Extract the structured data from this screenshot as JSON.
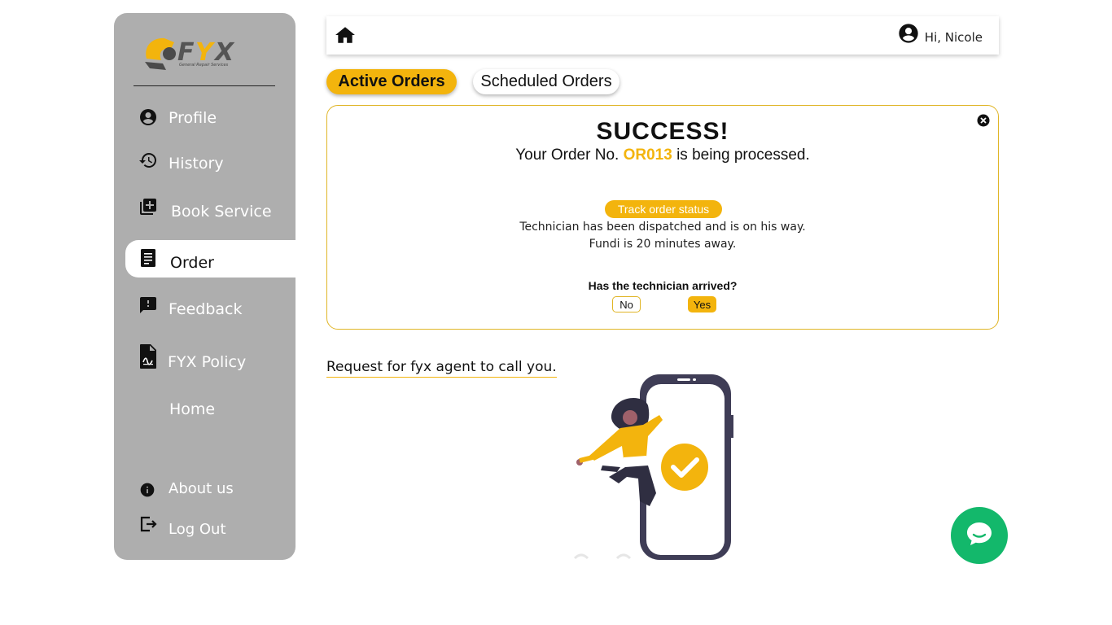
{
  "sidebar": {
    "logo_text": "FYX",
    "logo_tagline": "General Repair Services",
    "items": [
      {
        "label": "Profile",
        "icon": "account-circle-icon"
      },
      {
        "label": "History",
        "icon": "history-icon"
      },
      {
        "label": "Book Service",
        "icon": "library-add-icon"
      },
      {
        "label": "Order",
        "icon": "receipt-icon",
        "active": true
      },
      {
        "label": "Feedback",
        "icon": "feedback-icon"
      },
      {
        "label": "FYX Policy",
        "icon": "policy-document-icon"
      },
      {
        "label": "Home",
        "icon": ""
      }
    ],
    "bottom_items": [
      {
        "label": "About us",
        "icon": "info-icon"
      },
      {
        "label": "Log Out",
        "icon": "logout-icon"
      }
    ]
  },
  "header": {
    "greeting": "Hi, Nicole"
  },
  "tabs": {
    "active": "Active Orders",
    "scheduled": "Scheduled Orders"
  },
  "success_card": {
    "title": "SUCCESS!",
    "order_prefix": "Your Order No.",
    "order_number": "OR013",
    "order_suffix": "is being processed.",
    "track_button": "Track order status",
    "status_line_1": "Technician has been dispatched and is on his way.",
    "status_line_2": "Fundi is 20 minutes away.",
    "arrival_question": "Has the technician arrived?",
    "no_label": "No",
    "yes_label": "Yes"
  },
  "agent_request": {
    "text": "Request for fyx agent to call you."
  },
  "colors": {
    "accent": "#f3b40d",
    "sidebar_bg": "#aeaeae",
    "chat_green": "#13b86b",
    "illustration_dark": "#3f3d56"
  }
}
